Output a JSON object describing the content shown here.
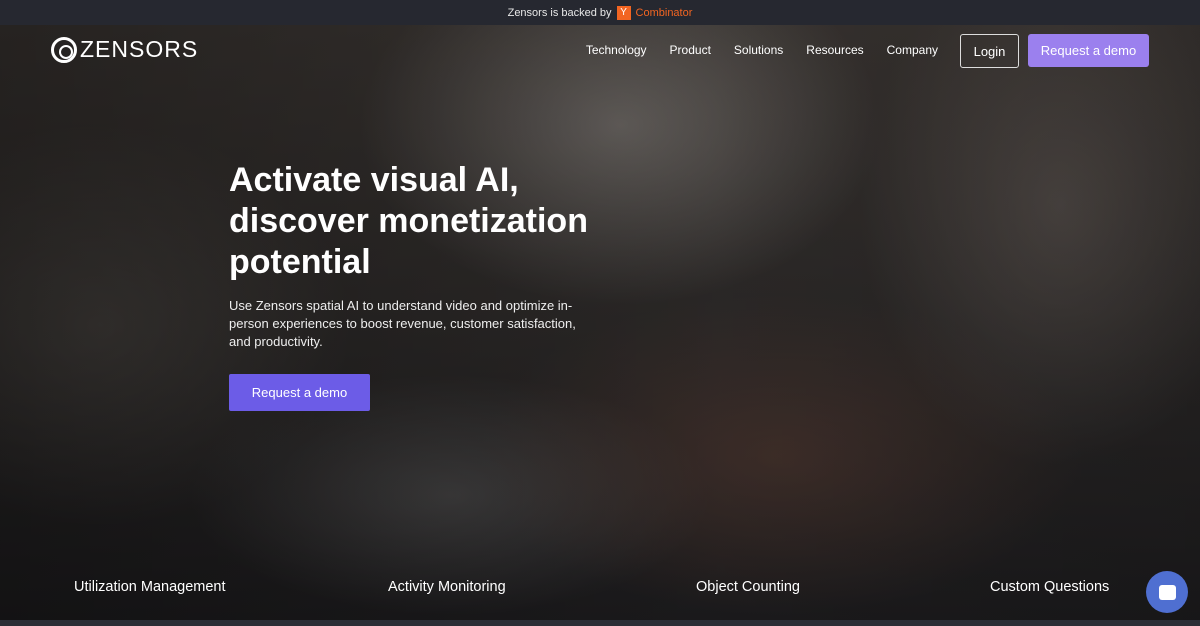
{
  "banner": {
    "text": "Zensors is backed by",
    "yc_letter": "Y",
    "yc_name": "Combinator"
  },
  "nav": {
    "logo": "ZENSORS",
    "items": [
      "Technology",
      "Product",
      "Solutions",
      "Resources",
      "Company"
    ],
    "login": "Login",
    "demo": "Request a demo"
  },
  "hero": {
    "title": "Activate visual AI, discover monetization potential",
    "subtitle": "Use Zensors spatial AI to understand video and optimize in-person experiences to boost revenue, customer satisfaction, and productivity.",
    "cta": "Request a demo"
  },
  "features": [
    "Utilization Management",
    "Activity Monitoring",
    "Object Counting",
    "Custom Questions"
  ]
}
